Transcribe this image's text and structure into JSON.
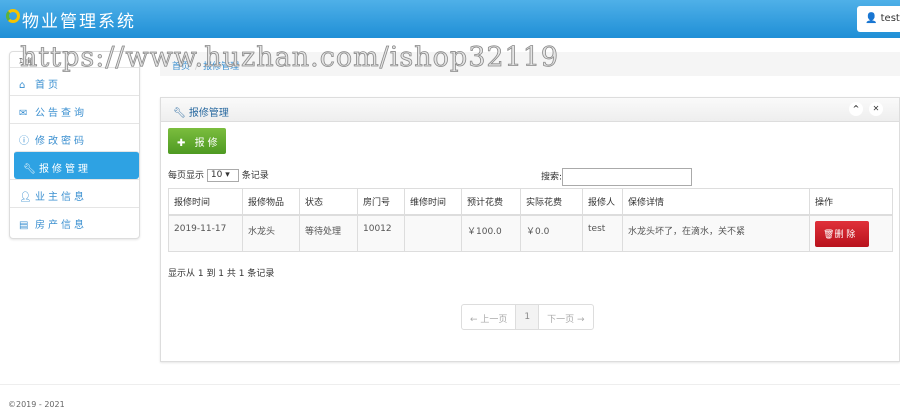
{
  "header": {
    "title": "物业管理系统",
    "user": "test"
  },
  "sidebar": {
    "heading": "功能",
    "items": [
      {
        "label": "首页",
        "icon": "home-icon"
      },
      {
        "label": "公告查询",
        "icon": "envelope-icon"
      },
      {
        "label": "修改密码",
        "icon": "info-icon"
      },
      {
        "label": "报修管理",
        "icon": "wrench-icon",
        "active": true
      },
      {
        "label": "业主信息",
        "icon": "user-icon"
      },
      {
        "label": "房产信息",
        "icon": "list-icon"
      }
    ]
  },
  "breadcrumb": [
    "首页",
    "报修管理"
  ],
  "panel": {
    "title": "报修管理",
    "add_label": "报修",
    "length_prefix": "每页显示",
    "length_value": "10",
    "length_suffix": "条记录",
    "search_label": "搜索:",
    "search_value": "",
    "columns": [
      "报修时间",
      "报修物品",
      "状态",
      "房门号",
      "维修时间",
      "预计花费",
      "实际花费",
      "报修人",
      "保修详情",
      "操作"
    ],
    "rows": [
      [
        "2019-11-17",
        "水龙头",
        "等待处理",
        "10012",
        "",
        "￥100.0",
        "￥0.0",
        "test",
        "水龙头坏了，在滴水，关不紧"
      ]
    ],
    "delete_label": "删 除",
    "info": "显示从 1 到 1 共 1 条记录",
    "pagination": {
      "prev": "← 上一页",
      "page": "1",
      "next": "下一页 →"
    }
  },
  "footer": "©2019 - 2021",
  "watermark": "https://www.huzhan.com/ishop32119"
}
